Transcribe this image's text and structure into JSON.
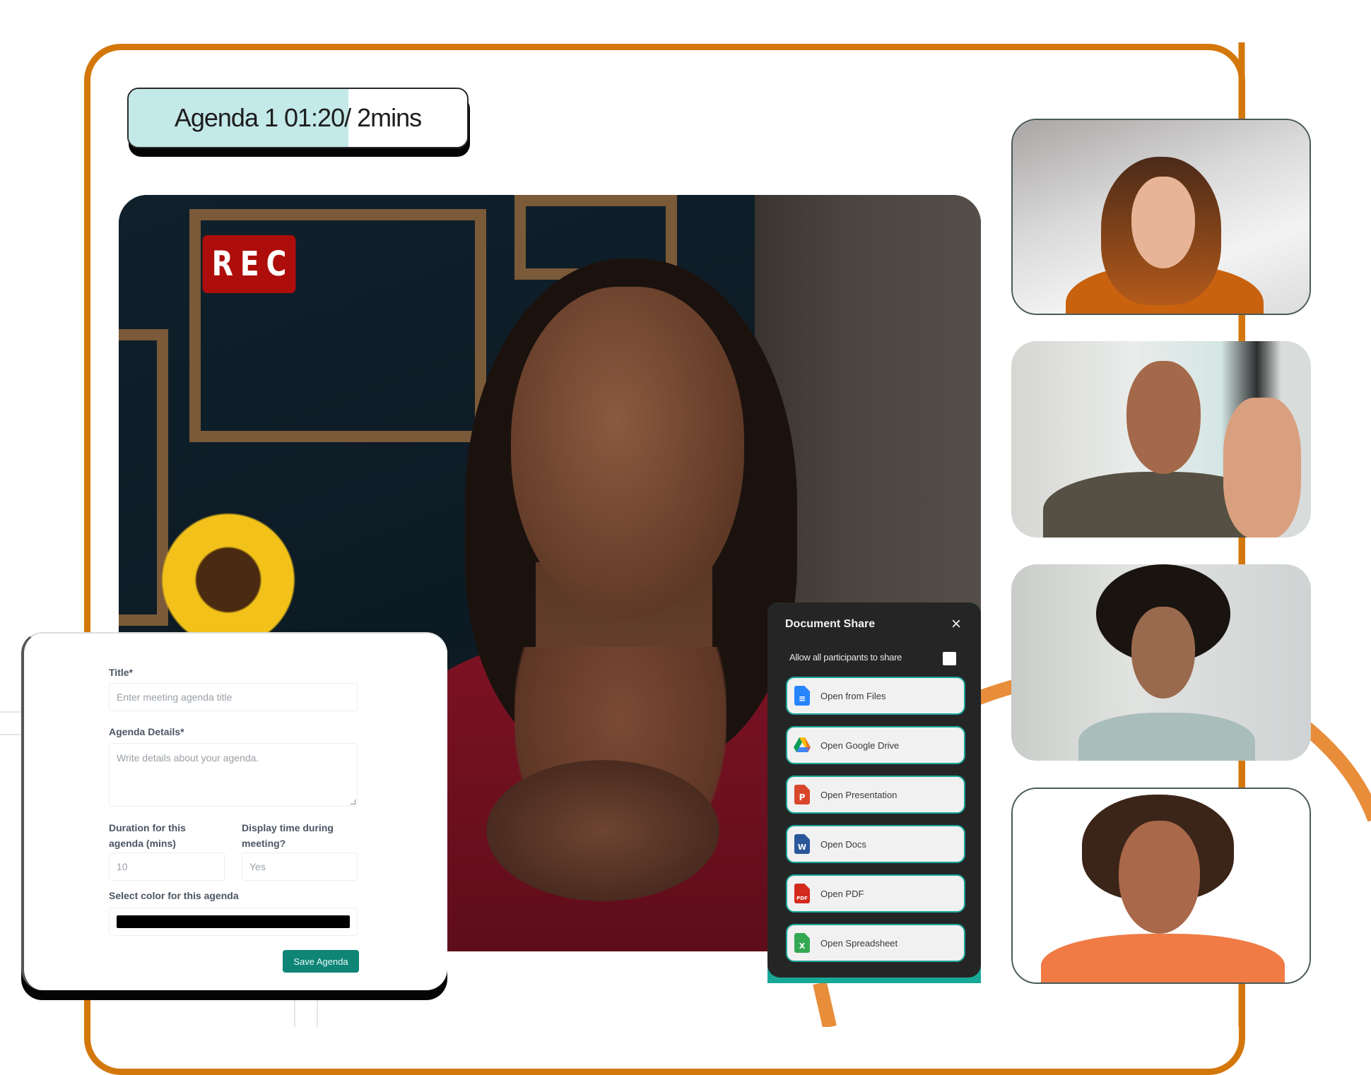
{
  "colors": {
    "frame_orange": "#D4770A",
    "arc_orange": "#E88D3A",
    "rec_red": "#AD0D0B",
    "agenda_fill": "#C3E9E8",
    "save_button": "#0E8577",
    "doc_panel_bg": "#252525",
    "doc_panel_accent": "#18A898"
  },
  "agenda_timer": {
    "label": "Agenda 1 01:20/ 2mins",
    "elapsed": "01:20",
    "total": "2mins",
    "progress": 0.65
  },
  "main_video": {
    "recording_badge": "REC"
  },
  "participants": [
    {
      "id": 1,
      "description": "woman with auburn hair, orange turtleneck"
    },
    {
      "id": 2,
      "description": "bald man with glasses waving"
    },
    {
      "id": 3,
      "description": "woman with curly hair, light blazer"
    },
    {
      "id": 4,
      "description": "man with locs, orange turtleneck"
    }
  ],
  "agenda_form": {
    "title_label": "Title*",
    "title_placeholder": "Enter meeting agenda title",
    "details_label": "Agenda Details*",
    "details_placeholder": "Write details about your agenda.",
    "duration_label": "Duration for this agenda (mins)",
    "duration_value": "10",
    "display_time_label": "Display time during meeting?",
    "display_time_value": "Yes",
    "color_label": "Select color for this agenda",
    "color_value": "#000000",
    "save_button": "Save Agenda"
  },
  "document_share": {
    "title": "Document Share",
    "close_icon": "×",
    "allow_all_label": "Allow all participants to share",
    "allow_all_checked": false,
    "options": [
      {
        "label": "Open from Files",
        "icon": "google-docs-file-icon",
        "color": "#2684FC",
        "glyph": "≡"
      },
      {
        "label": "Open Google Drive",
        "icon": "google-drive-icon",
        "color": "#FBBC04",
        "glyph": ""
      },
      {
        "label": "Open Presentation",
        "icon": "powerpoint-file-icon",
        "color": "#D9472B",
        "glyph": "P"
      },
      {
        "label": "Open Docs",
        "icon": "word-file-icon",
        "color": "#2B579A",
        "glyph": "W"
      },
      {
        "label": "Open PDF",
        "icon": "pdf-file-icon",
        "color": "#D42A1E",
        "glyph": "PDF"
      },
      {
        "label": "Open Spreadsheet",
        "icon": "excel-file-icon",
        "color": "#34A853",
        "glyph": "X"
      }
    ]
  }
}
